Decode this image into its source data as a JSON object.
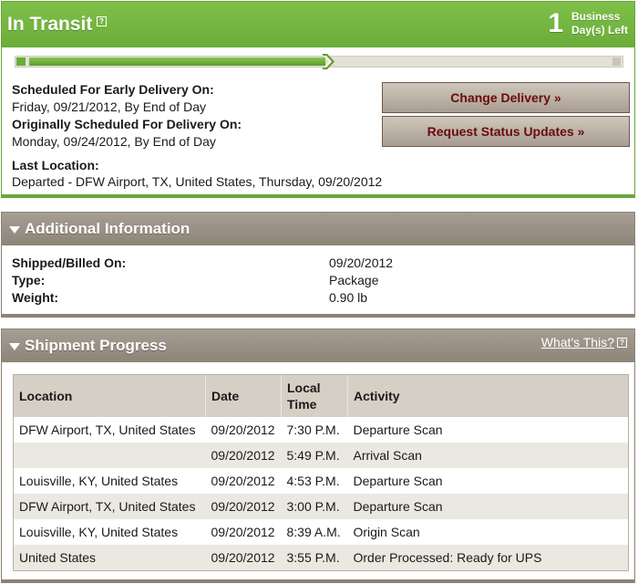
{
  "status": {
    "title": "In Transit",
    "help_glyph": "?",
    "days_left_number": "1",
    "days_left_label_1": "Business",
    "days_left_label_2": "Day(s) Left",
    "progress_fraction": 0.5
  },
  "delivery": {
    "early_label": "Scheduled For Early Delivery On:",
    "early_value": "Friday, 09/21/2012, By End of Day",
    "original_label": "Originally Scheduled For Delivery On:",
    "original_value": "Monday, 09/24/2012, By End of Day",
    "last_location_label": "Last Location:",
    "last_location_value": "Departed - DFW Airport, TX, United States, Thursday, 09/20/2012"
  },
  "buttons": {
    "change_delivery": "Change Delivery »",
    "request_updates": "Request Status Updates »"
  },
  "additional": {
    "title": "Additional Information",
    "rows": [
      {
        "label": "Shipped/Billed On:",
        "value": "09/20/2012"
      },
      {
        "label": "Type:",
        "value": "Package"
      },
      {
        "label": "Weight:",
        "value": "0.90 lb"
      }
    ]
  },
  "progress_section": {
    "title": "Shipment Progress",
    "whats_this": "What's This?",
    "columns": [
      "Location",
      "Date",
      "Local Time",
      "Activity"
    ],
    "rows": [
      {
        "location": "DFW Airport, TX, United States",
        "date": "09/20/2012",
        "time": "7:30 P.M.",
        "activity": "Departure Scan"
      },
      {
        "location": "",
        "date": "09/20/2012",
        "time": "5:49 P.M.",
        "activity": "Arrival Scan"
      },
      {
        "location": "Louisville, KY, United States",
        "date": "09/20/2012",
        "time": "4:53 P.M.",
        "activity": "Departure Scan"
      },
      {
        "location": "DFW Airport, TX, United States",
        "date": "09/20/2012",
        "time": "3:00 P.M.",
        "activity": "Departure Scan"
      },
      {
        "location": "Louisville, KY, United States",
        "date": "09/20/2012",
        "time": "8:39 A.M.",
        "activity": "Origin Scan"
      },
      {
        "location": "United States",
        "date": "09/20/2012",
        "time": "3:55 P.M.",
        "activity": "Order Processed: Ready for UPS"
      }
    ]
  },
  "colors": {
    "status_green": "#6aad38",
    "panel_taupe": "#8d8478",
    "button_text": "#6b0a0a"
  }
}
